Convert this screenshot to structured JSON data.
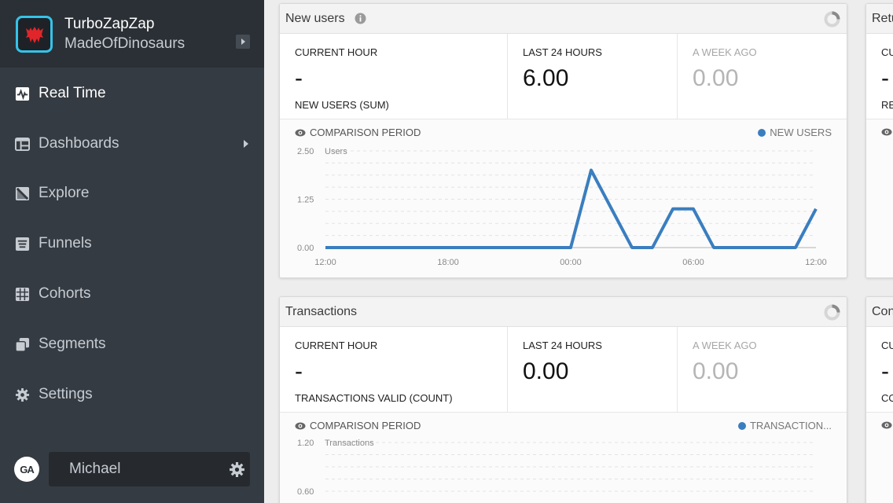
{
  "app": {
    "name": "TurboZapZap",
    "org": "MadeOfDinosaurs"
  },
  "sidebar": {
    "items": [
      {
        "label": "Real Time",
        "icon": "pulse-icon",
        "active": true
      },
      {
        "label": "Dashboards",
        "icon": "dashboard-icon",
        "has_submenu": true
      },
      {
        "label": "Explore",
        "icon": "explore-icon"
      },
      {
        "label": "Funnels",
        "icon": "funnel-icon"
      },
      {
        "label": "Cohorts",
        "icon": "cohorts-icon"
      },
      {
        "label": "Segments",
        "icon": "segments-icon"
      },
      {
        "label": "Settings",
        "icon": "gear-icon"
      }
    ],
    "user": {
      "badge": "GA",
      "name": "Michael"
    }
  },
  "colors": {
    "accent": "#3a7ebf",
    "sidebar_bg": "#353b42",
    "logo_border": "#35c3e8",
    "logo_fill": "#e0262a"
  },
  "cards": {
    "new_users": {
      "title": "New users",
      "current_hour_label": "CURRENT HOUR",
      "current_hour_value": "-",
      "metric_name": "NEW USERS (SUM)",
      "last24_label": "LAST 24 HOURS",
      "last24_value": "6.00",
      "week_ago_label": "A WEEK AGO",
      "week_ago_value": "0.00",
      "comparison_label": "COMPARISON PERIOD",
      "legend_label": "NEW USERS"
    },
    "transactions": {
      "title": "Transactions",
      "current_hour_label": "CURRENT HOUR",
      "current_hour_value": "-",
      "metric_name": "TRANSACTIONS VALID (COUNT)",
      "last24_label": "LAST 24 HOURS",
      "last24_value": "0.00",
      "week_ago_label": "A WEEK AGO",
      "week_ago_value": "0.00",
      "comparison_label": "COMPARISON PERIOD",
      "legend_label": "TRANSACTION..."
    },
    "right_top": {
      "title": "Retu",
      "current_hour_label": "CU",
      "current_hour_value": "-",
      "metric_name": "RE"
    },
    "right_bottom": {
      "title": "Con",
      "current_hour_label": "CU",
      "current_hour_value": "-",
      "metric_name": "CO"
    }
  },
  "chart_data": [
    {
      "type": "line",
      "ylabel": "Users",
      "yticks": [
        "0.00",
        "1.25",
        "2.50"
      ],
      "ylim": [
        0,
        2.5
      ],
      "xticks": [
        "12:00",
        "18:00",
        "00:00",
        "06:00",
        "12:00"
      ],
      "x_hours": [
        0,
        1,
        2,
        3,
        4,
        5,
        6,
        7,
        8,
        9,
        10,
        11,
        12,
        13,
        14,
        15,
        16,
        17,
        18,
        19,
        20,
        21,
        22,
        23,
        24
      ],
      "series": [
        {
          "name": "NEW USERS",
          "values": [
            0,
            0,
            0,
            0,
            0,
            0,
            0,
            0,
            0,
            0,
            0,
            0,
            0,
            2,
            1,
            0,
            0,
            1,
            1,
            0,
            0,
            0,
            0,
            0,
            1
          ]
        }
      ],
      "legend": "top-right",
      "grid": true
    },
    {
      "type": "line",
      "ylabel": "Transactions",
      "yticks": [
        "0.60",
        "1.20"
      ],
      "ylim": [
        0,
        1.2
      ],
      "series": [
        {
          "name": "TRANSACTION...",
          "values": []
        }
      ],
      "legend": "top-right",
      "grid": true
    }
  ]
}
